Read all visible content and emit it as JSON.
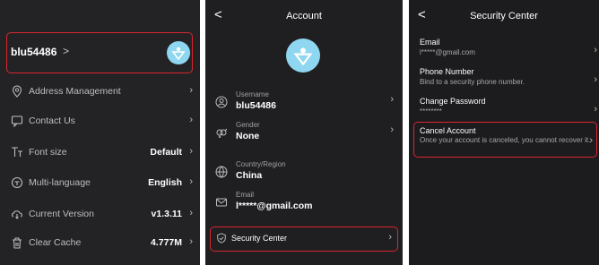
{
  "colors": {
    "accent": "#d9262f",
    "avatar_bg": "#8fd7f0"
  },
  "profile": {
    "username": "blu54486",
    "chevron": ">",
    "rows": [
      {
        "icon": "location-icon",
        "label": "Address Management",
        "value": ""
      },
      {
        "icon": "chat-icon",
        "label": "Contact Us",
        "value": ""
      },
      {
        "icon": "font-size-icon",
        "label": "Font size",
        "value": "Default"
      },
      {
        "icon": "language-icon",
        "label": "Multi-language",
        "value": "English"
      },
      {
        "icon": "version-icon",
        "label": "Current Version",
        "value": "v1.3.11"
      },
      {
        "icon": "trash-icon",
        "label": "Clear Cache",
        "value": "4.777M"
      }
    ]
  },
  "account": {
    "back": "<",
    "title": "Account",
    "fields": [
      {
        "icon": "user-icon",
        "caption": "Username",
        "value": "blu54486"
      },
      {
        "icon": "gender-icon",
        "caption": "Gender",
        "value": "None"
      },
      {
        "icon": "globe-icon",
        "caption": "Country/Region",
        "value": "China"
      },
      {
        "icon": "mail-icon",
        "caption": "Email",
        "value": "l*****@gmail.com"
      }
    ],
    "security_label": "Security Center"
  },
  "security": {
    "back": "<",
    "title": "Security Center",
    "items": [
      {
        "title": "Email",
        "sub": "l*****@gmail.com"
      },
      {
        "title": "Phone Number",
        "sub": "Bind to a security phone number."
      },
      {
        "title": "Change Password",
        "sub": "********"
      }
    ],
    "cancel": {
      "title": "Cancel Account",
      "sub": "Once your account is canceled, you cannot recover it."
    }
  }
}
